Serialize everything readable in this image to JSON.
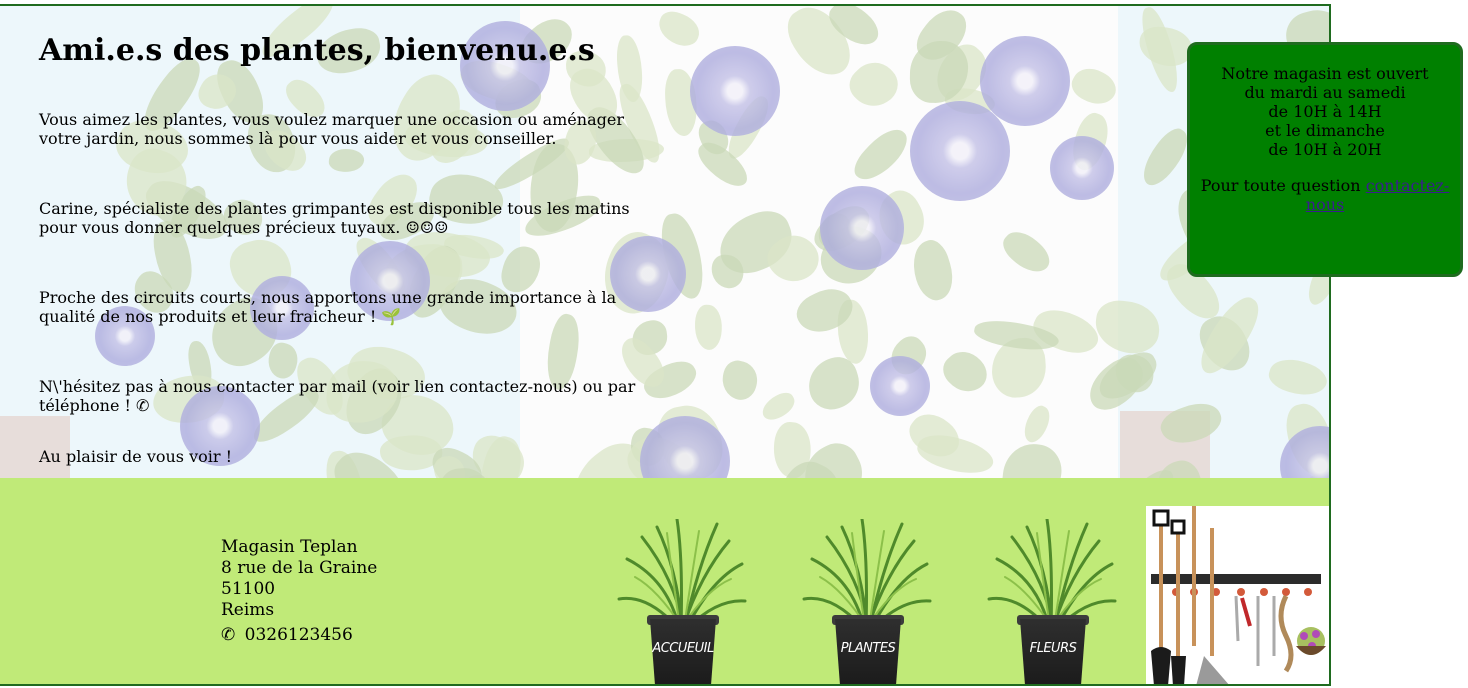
{
  "page": {
    "title": "Ami.e.s des plantes, bienvenu.e.s",
    "paragraphs": [
      "Vous aimez les plantes, vous voulez marquer une occasion ou aménager votre jardin, nous sommes là pour vous aider et vous conseiller.",
      "Carine, spécialiste des plantes grimpantes est disponible tous les matins pour vous donner quelques précieux tuyaux. ☺☺☺",
      "Proche des circuits courts, nous apportons une grande importance à la qualité de nos produits et leur fraicheur ! 🌱",
      "N\\'hésitez pas à nous contacter par mail (voir lien contactez-nous) ou par téléphone ! ✆",
      "Au plaisir de vous voir !"
    ]
  },
  "hours": {
    "lines": [
      "Notre magasin est ouvert",
      "du mardi au samedi",
      "de 10H à 14H",
      "et le dimanche",
      "de 10H à 20H"
    ],
    "question_text": "Pour toute question ",
    "contact_link": "contactez-nous"
  },
  "footer": {
    "address": [
      "Magasin Teplan",
      "8 rue de la Graine",
      "51100",
      "Reims"
    ],
    "phone_icon": "✆",
    "phone": "0326123456",
    "nav": [
      {
        "label": "ACCUEUIL"
      },
      {
        "label": "PLANTES"
      },
      {
        "label": "FLEURS"
      }
    ],
    "colors": {
      "footer_bg": "#c0ea78",
      "hours_bg": "#008000",
      "border": "#1f6b1f"
    }
  }
}
